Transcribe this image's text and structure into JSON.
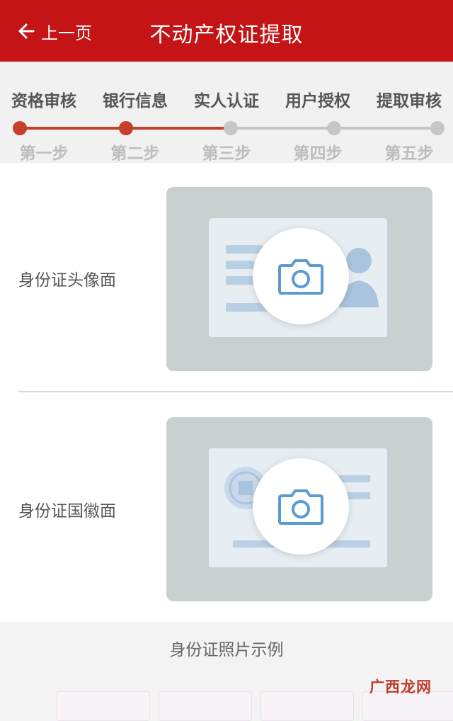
{
  "header": {
    "back_label": "上一页",
    "title": "不动产权证提取",
    "bg_color": "#c41415"
  },
  "steps": [
    {
      "label": "资格审核",
      "sub": "第一步",
      "state": "done"
    },
    {
      "label": "银行信息",
      "sub": "第二步",
      "state": "done"
    },
    {
      "label": "实人认证",
      "sub": "第三步",
      "state": "pending"
    },
    {
      "label": "用户授权",
      "sub": "第四步",
      "state": "pending"
    },
    {
      "label": "提取审核",
      "sub": "第五步",
      "state": "pending"
    }
  ],
  "progress": {
    "completed_steps": 2,
    "total_steps": 5,
    "active_color": "#c63f2a",
    "inactive_color": "#c6c6c6"
  },
  "uploads": {
    "front": {
      "label": "身份证头像面",
      "icon": "camera-icon"
    },
    "back": {
      "label": "身份证国徽面",
      "icon": "camera-icon"
    }
  },
  "example": {
    "title": "身份证照片示例"
  },
  "watermark": {
    "text": "广西龙网"
  }
}
